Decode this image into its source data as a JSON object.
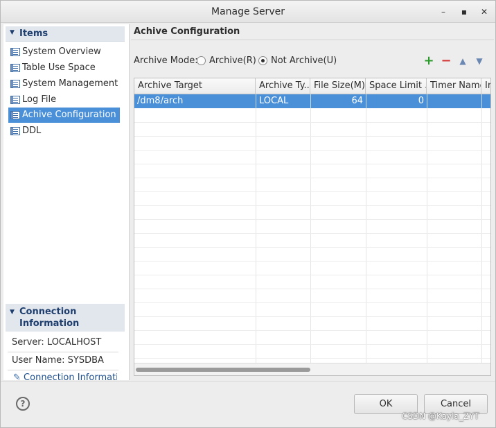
{
  "window": {
    "title": "Manage Server",
    "minimize_glyph": "–",
    "maximize_glyph": "▪",
    "close_glyph": "✕"
  },
  "sidebar": {
    "items_header": "Items",
    "items": [
      {
        "label": "System Overview",
        "icon": "table-icon",
        "selected": false
      },
      {
        "label": "Table Use Space",
        "icon": "table-icon",
        "selected": false
      },
      {
        "label": "System Management",
        "icon": "table-icon",
        "selected": false
      },
      {
        "label": "Log File",
        "icon": "table-icon",
        "selected": false
      },
      {
        "label": "Achive Configuration",
        "icon": "table-icon",
        "selected": true
      },
      {
        "label": "DDL",
        "icon": "table-icon",
        "selected": false
      }
    ],
    "connection_header": "Connection Information",
    "server_line": "Server: LOCALHOST",
    "user_line": "User Name: SYSDBA",
    "connection_link": "Connection Information"
  },
  "main": {
    "section_title": "Achive Configuration",
    "archive_mode_label": "Archive Mode:",
    "radio_options": [
      {
        "label": "Archive(R)",
        "checked": false
      },
      {
        "label": "Not Archive(U)",
        "checked": true
      }
    ],
    "toolbar": {
      "add_glyph": "+",
      "remove_glyph": "−",
      "up_glyph": "▲",
      "down_glyph": "▼"
    },
    "table": {
      "columns": [
        "Archive Target",
        "Archive Ty...",
        "File Size(M)",
        "Space Limit ...",
        "Timer Name",
        "Ir"
      ],
      "rows": [
        {
          "target": "/dm8/arch",
          "type": "LOCAL",
          "file_size": "64",
          "space_limit": "0",
          "timer_name": "",
          "extra": ""
        }
      ]
    }
  },
  "footer": {
    "help_glyph": "?",
    "ok_label": "OK",
    "cancel_label": "Cancel"
  },
  "watermark": "CSDN @Kayla_ZYT",
  "colors": {
    "selection": "#4a90d9",
    "header_text": "#1f3f6e",
    "add": "#2a9a2a",
    "remove": "#d43535"
  }
}
